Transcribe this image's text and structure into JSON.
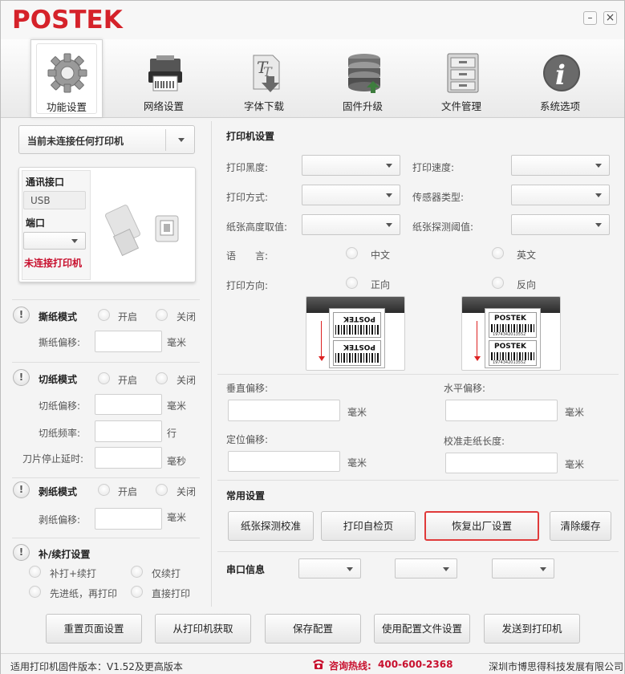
{
  "app": {
    "brand": "POSTEK",
    "minimize": "–",
    "close": "×"
  },
  "toolbar": [
    {
      "label": "功能设置",
      "icon": "gear-icon"
    },
    {
      "label": "网络设置",
      "icon": "printer-icon"
    },
    {
      "label": "字体下载",
      "icon": "font-download-icon"
    },
    {
      "label": "固件升级",
      "icon": "database-upgrade-icon"
    },
    {
      "label": "文件管理",
      "icon": "file-cabinet-icon"
    },
    {
      "label": "系统选项",
      "icon": "info-icon"
    }
  ],
  "left": {
    "printer_select": "当前未连接任何打印机",
    "interface_label": "通讯接口",
    "interface_value": "USB",
    "port_label": "端口",
    "port_value": "",
    "status": "未连接打印机",
    "tear": {
      "title": "撕纸模式",
      "on": "开启",
      "off": "关闭",
      "offset_label": "撕纸偏移:",
      "unit": "毫米"
    },
    "cut": {
      "title": "切纸模式",
      "on": "开启",
      "off": "关闭",
      "offset_label": "切纸偏移:",
      "offset_unit": "毫米",
      "freq_label": "切纸频率:",
      "freq_unit": "行",
      "delay_label": "刀片停止延时:",
      "delay_unit": "毫秒"
    },
    "peel": {
      "title": "剥纸模式",
      "on": "开启",
      "off": "关闭",
      "offset_label": "剥纸偏移:",
      "unit": "毫米"
    },
    "reprint": {
      "title": "补/续打设置",
      "opt1": "补打+续打",
      "opt2": "仅续打",
      "opt3": "先进纸，再打印",
      "opt4": "直接打印"
    }
  },
  "right": {
    "printer_settings": "打印机设置",
    "darkness": "打印黑度:",
    "speed": "打印速度:",
    "method": "打印方式:",
    "sensor": "传感器类型:",
    "paper_height": "纸张高度取值:",
    "detect_threshold": "纸张探测阈值:",
    "language_label": "语　　言:",
    "lang_cn": "中文",
    "lang_en": "英文",
    "direction_label": "打印方向:",
    "dir_normal": "正向",
    "dir_reverse": "反向",
    "label_brand": "POSTEK",
    "label_number": "1974342013552",
    "vertical_offset": "垂直偏移:",
    "horizontal_offset": "水平偏移:",
    "position_offset": "定位偏移:",
    "calib_length": "校准走纸长度:",
    "unit_mm": "毫米",
    "common_settings": "常用设置",
    "btn_calibrate": "纸张探测校准",
    "btn_selftest": "打印自检页",
    "btn_factory": "恢复出厂设置",
    "btn_clear": "清除缓存",
    "serial_info": "串口信息"
  },
  "bottom": {
    "btn_reset": "重置页面设置",
    "btn_fetch": "从打印机获取",
    "btn_save": "保存配置",
    "btn_use_file": "使用配置文件设置",
    "btn_send": "发送到打印机"
  },
  "status": {
    "firmware": "适用打印机固件版本：V1.52及更高版本",
    "hotline_label": "咨询热线:",
    "hotline_number": "400-600-2368",
    "company": "深圳市博思得科技发展有限公司"
  },
  "colors": {
    "brand": "#d5222a",
    "alert": "#c8102e",
    "highlight_border": "#e03a3a"
  }
}
